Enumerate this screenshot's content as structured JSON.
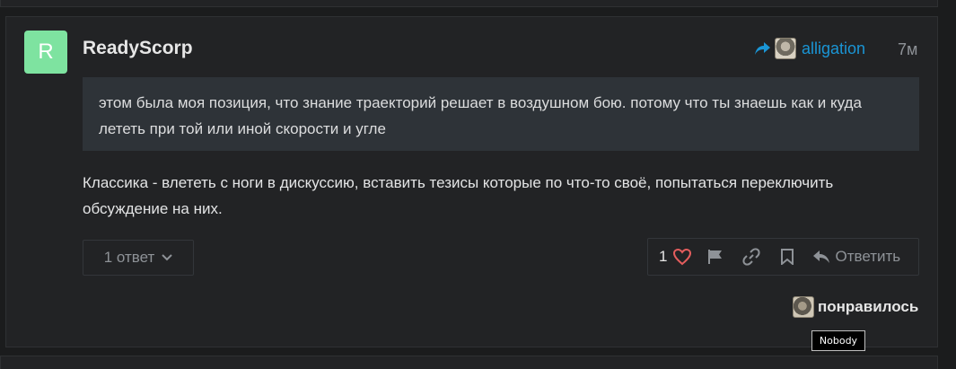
{
  "post": {
    "avatar_letter": "R",
    "avatar_color": "#7ee3a0",
    "username": "ReadyScorp",
    "reply_to": {
      "icon": "share-arrow-icon",
      "username": "alligation"
    },
    "date": "7м",
    "quote": "этом была моя позиция, что знание траекторий решает в воздушном бою. потому что ты знаешь как и куда лететь при той или иной скорости и угле",
    "body": "Классика - влететь с ноги в дискуссию, вставить тезисы которые по что-то своё, попытаться переключить обсуждение на них.",
    "replies_label": "1 ответ",
    "actions": {
      "like_count": "1",
      "reply_label": "Ответить"
    },
    "liked_by_label": "понравилось",
    "tooltip": "Nobody"
  },
  "colors": {
    "accent": "#1a95d5",
    "heart": "#e45d5d",
    "background": "#222325",
    "quote_bg": "#2e3338"
  }
}
